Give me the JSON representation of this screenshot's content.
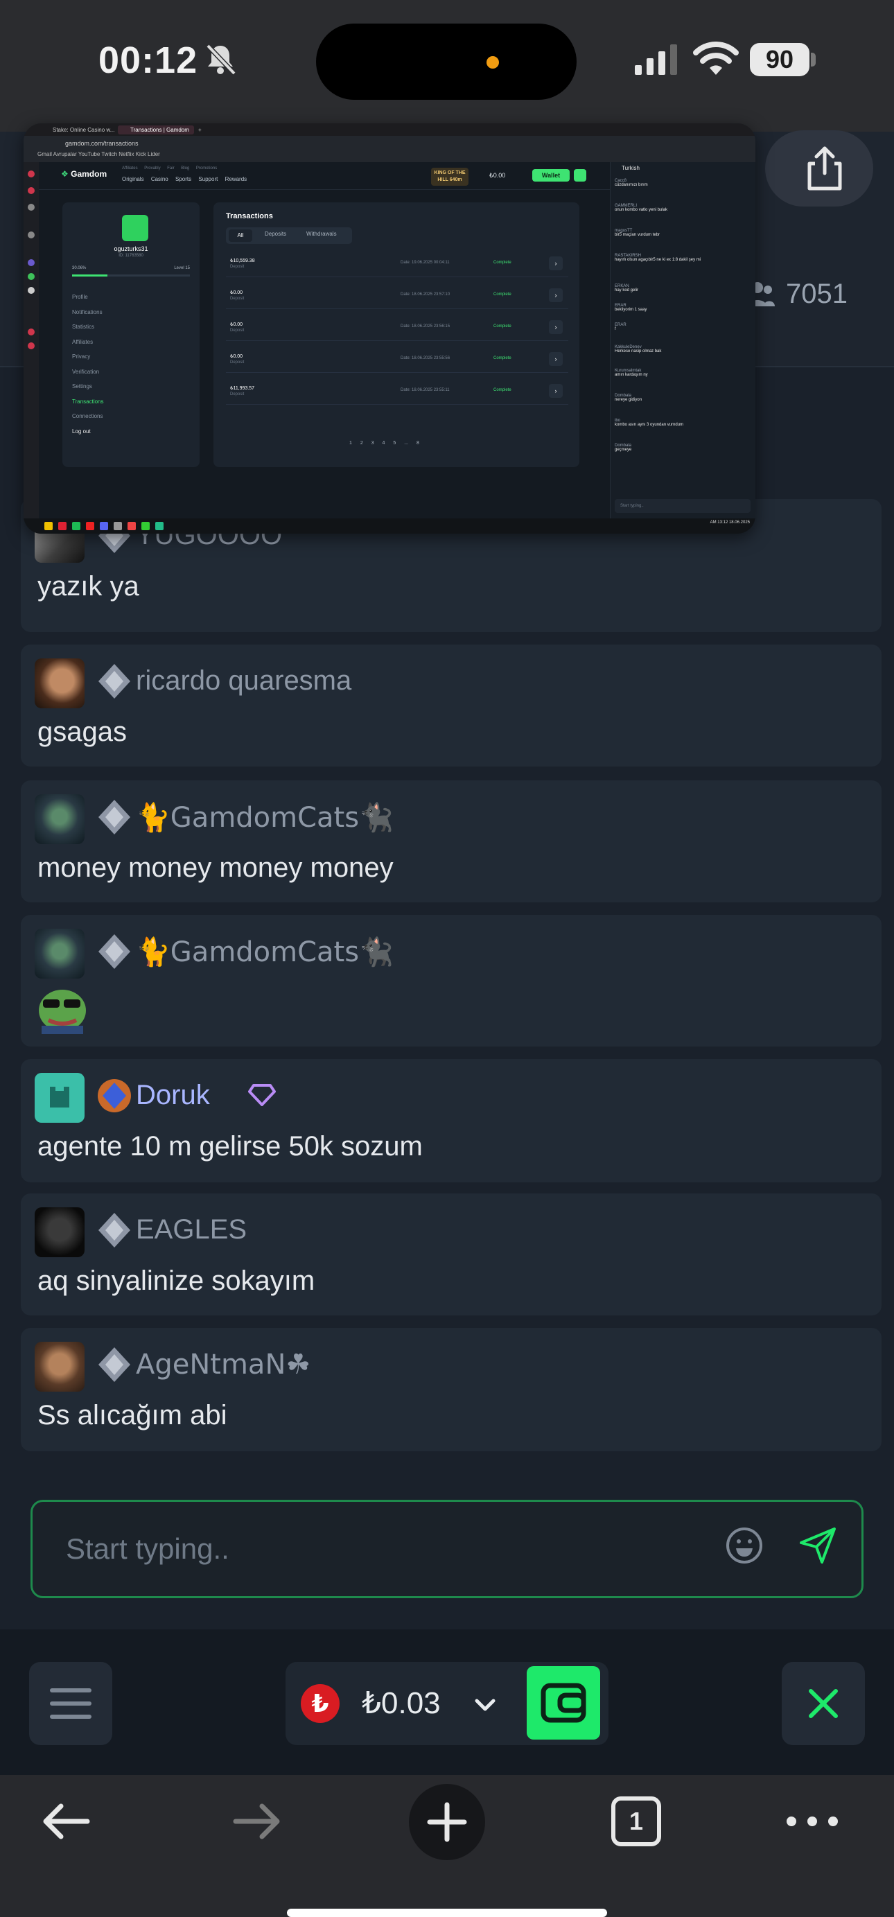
{
  "status_bar": {
    "time": "00:12",
    "battery": "90"
  },
  "chat_header": {
    "online_count": "7051"
  },
  "pip": {
    "tabs": [
      "Stake: Online Casino w...",
      "Transactions | Gamdom",
      "+"
    ],
    "url": "gamdom.com/transactions",
    "bookmarks": "Gmail  Avrupalar  YouTube  Twitch  Netflix  Kick  Lider",
    "site": {
      "logo": "Gamdom",
      "submenu": "Affiliates  Provably Fair  Blog  Promotions",
      "menu": [
        "Originals",
        "Casino",
        "Sports",
        "Support",
        "Rewards"
      ],
      "king_of_hill": "KING OF THE HILL 640m",
      "balance": "₺0.00",
      "wallet_label": "Wallet"
    },
    "profile": {
      "username": "oguzturks31",
      "id": "ID: 11763580",
      "xp_left": "30.06%",
      "xp_right": "Level 15",
      "menu": [
        "Profile",
        "Notifications",
        "Statistics",
        "Affiliates",
        "Privacy",
        "Verification",
        "Settings",
        "Transactions",
        "Connections",
        "Log out"
      ]
    },
    "transactions": {
      "title": "Transactions",
      "filters": [
        "All",
        "Deposits",
        "Withdrawals"
      ],
      "rows": [
        {
          "amount": "₺10,559.38",
          "type": "Deposit",
          "date": "Date: 19.06.2025 00:04:11",
          "status": "Complete"
        },
        {
          "amount": "₺0.00",
          "type": "Deposit",
          "date": "Date: 18.06.2025 23:57:10",
          "status": "Complete"
        },
        {
          "amount": "₺0.00",
          "type": "Deposit",
          "date": "Date: 18.06.2025 23:56:15",
          "status": "Complete"
        },
        {
          "amount": "₺0.00",
          "type": "Deposit",
          "date": "Date: 18.06.2025 23:55:56",
          "status": "Complete"
        },
        {
          "amount": "₺11,993.57",
          "type": "Deposit",
          "date": "Date: 18.06.2025 23:55:11",
          "status": "Complete"
        }
      ],
      "pagination": "1 2 3 4 5 ... 8"
    },
    "chat": {
      "language": "Turkish",
      "messages": [
        {
          "user": "Cacc8",
          "text": "cüzdanımızı bırım"
        },
        {
          "user": "GAMMERLI",
          "text": "onun kombo vatlo yeni bulak"
        },
        {
          "user": "magusTT",
          "text": "bir5 maçları vurdum tebr"
        },
        {
          "user": "RASTAKIRSH",
          "text": "hayırlı olsun agaçıbir5 ne ki ex 1:8 dakil şey mi"
        },
        {
          "user": "ERKAN",
          "text": "hay kod gelir"
        },
        {
          "user": "ERAR",
          "text": "bekliyorim 1 saay"
        },
        {
          "user": "ERAR",
          "text": "f"
        },
        {
          "user": "KakkuleDenev",
          "text": "Herkese nasip olmaz bak"
        },
        {
          "user": "Kurumsalmtak",
          "text": "amın kardaşım ny"
        },
        {
          "user": "Dombala",
          "text": "nereye gidiyon"
        },
        {
          "user": "ibo",
          "text": "kombo asırı aynı 3 oyundan vurndum"
        },
        {
          "user": "Dombala",
          "text": "geçmeye"
        }
      ],
      "input_placeholder": "Start typing.."
    },
    "clock": "AM 13:12 18.06.2025"
  },
  "messages": [
    {
      "username": "YUGOOOO",
      "text": "yazık ya",
      "vip": false
    },
    {
      "username": "ricardo quaresma",
      "text": "gsagas",
      "vip": false
    },
    {
      "username": "🐈GamdomCats🐈‍⬛",
      "text": "money money money money",
      "vip": false
    },
    {
      "username": "🐈GamdomCats🐈‍⬛",
      "text": "",
      "vip": false
    },
    {
      "username": "Doruk",
      "text": "agente 10 m gelirse 50k sozum",
      "vip": true
    },
    {
      "username": "EAGLES",
      "text": "aq sinyalinize sokayım",
      "vip": false
    },
    {
      "username": "AgeNtmaN☘",
      "text": "Ss alıcağım abi",
      "vip": false
    }
  ],
  "input": {
    "placeholder": "Start typing.."
  },
  "wallet": {
    "currency_symbol": "₺",
    "balance": "₺0.03"
  },
  "browser": {
    "tab_count": "1"
  },
  "colors": {
    "accent": "#1ee96a",
    "background": "#1a212b",
    "card": "#212a35",
    "vip_name": "#a9b6ff"
  }
}
